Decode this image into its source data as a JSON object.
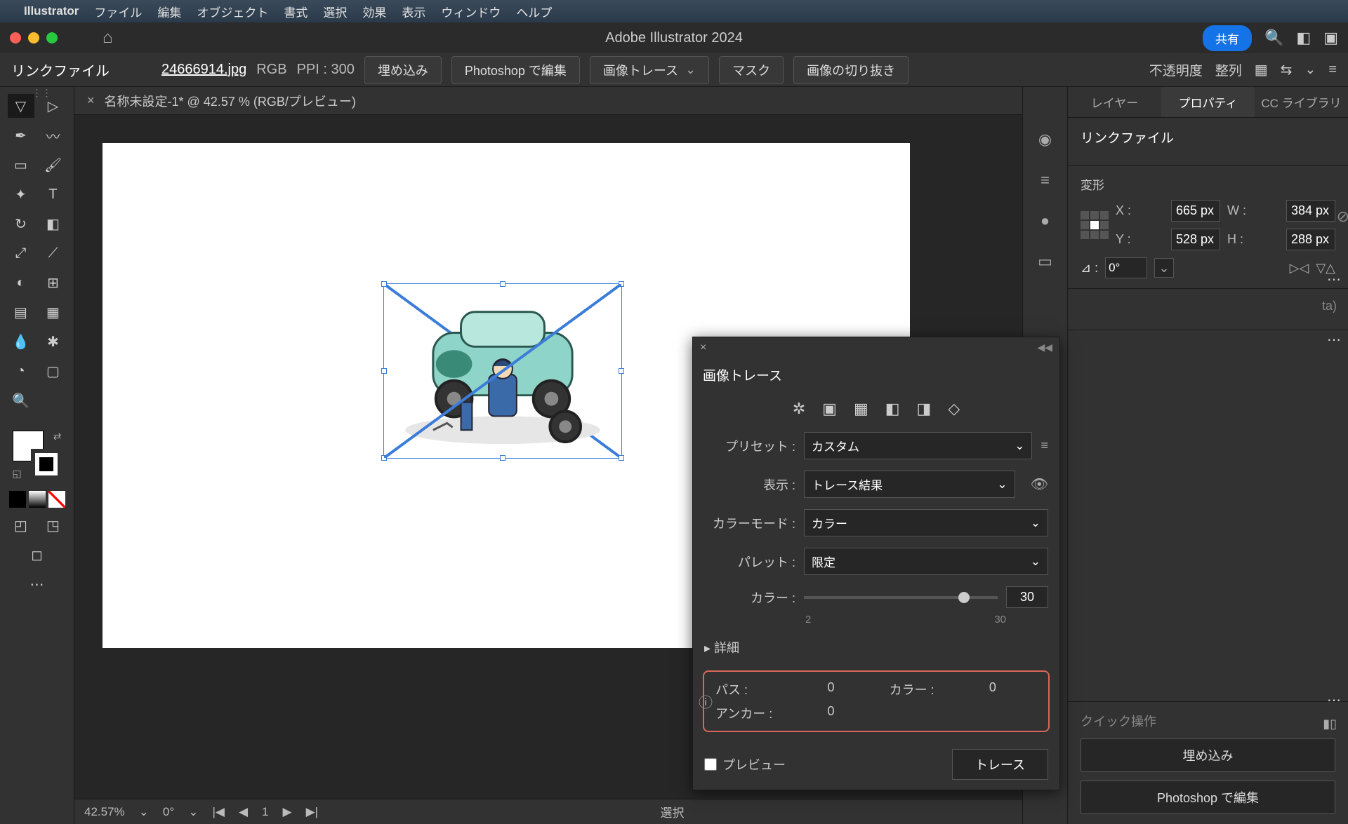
{
  "menubar": {
    "app": "Illustrator",
    "items": [
      "ファイル",
      "編集",
      "オブジェクト",
      "書式",
      "選択",
      "効果",
      "表示",
      "ウィンドウ",
      "ヘルプ"
    ]
  },
  "titlebar": {
    "title": "Adobe Illustrator 2024",
    "share": "共有"
  },
  "control": {
    "label": "リンクファイル",
    "filename": "24666914.jpg",
    "colormode": "RGB",
    "ppi": "PPI : 300",
    "embed": "埋め込み",
    "psedit": "Photoshop で編集",
    "imgtrace": "画像トレース",
    "mask": "マスク",
    "crop": "画像の切り抜き",
    "opacity": "不透明度",
    "align": "整列"
  },
  "docTab": {
    "name": "名称未設定-1* @ 42.57 % (RGB/プレビュー)"
  },
  "status": {
    "zoom": "42.57%",
    "rotate": "0°",
    "sel": "選択"
  },
  "rightTabs": [
    "レイヤー",
    "プロパティ",
    "CC ライブラリ"
  ],
  "props": {
    "title": "リンクファイル",
    "transform": "変形",
    "x": "665 px",
    "y": "528 px",
    "w": "384 px",
    "h": "288 px",
    "xL": "X :",
    "yL": "Y :",
    "wL": "W :",
    "hL": "H :",
    "angleL": "⊿ :",
    "angle": "0°",
    "beta": "ta)",
    "quickTitle": "クイック操作",
    "embedBtn": "埋め込み",
    "psBtn": "Photoshop で編集"
  },
  "trace": {
    "title": "画像トレース",
    "preset": "プリセット :",
    "presetVal": "カスタム",
    "view": "表示 :",
    "viewVal": "トレース結果",
    "mode": "カラーモード :",
    "modeVal": "カラー",
    "palette": "パレット :",
    "paletteVal": "限定",
    "colors": "カラー :",
    "colorsVal": "30",
    "sliderMin": "2",
    "sliderMax": "30",
    "detail": "詳細",
    "pathL": "パス :",
    "pathV": "0",
    "colorL": "カラー :",
    "colorV": "0",
    "anchorL": "アンカー :",
    "anchorV": "0",
    "preview": "プレビュー",
    "go": "トレース"
  }
}
